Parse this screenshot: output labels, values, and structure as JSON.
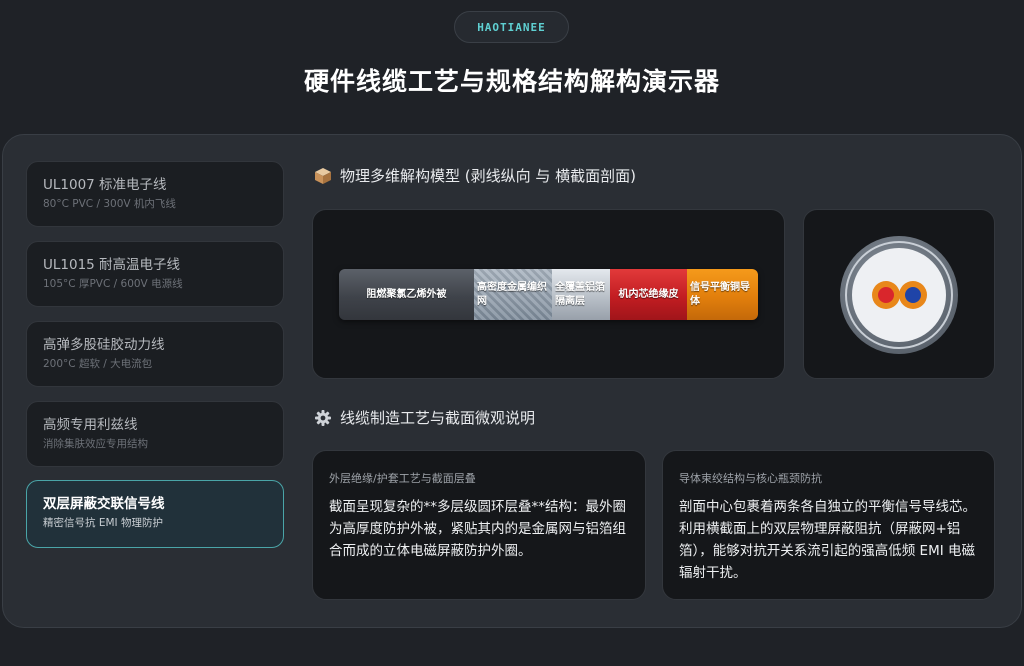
{
  "brand": "HAOTIANEE",
  "page_title": "硬件线缆工艺与规格结构解构演示器",
  "sidebar": {
    "items": [
      {
        "name": "UL1007 标准电子线",
        "sub": "80°C PVC / 300V 机内飞线"
      },
      {
        "name": "UL1015 耐高温电子线",
        "sub": "105°C 厚PVC / 600V 电源线"
      },
      {
        "name": "高弹多股硅胶动力线",
        "sub": "200°C 超软 / 大电流包"
      },
      {
        "name": "高频专用利兹线",
        "sub": "消除集肤效应专用结构"
      },
      {
        "name": "双层屏蔽交联信号线",
        "sub": "精密信号抗 EMI 物理防护"
      }
    ],
    "active_index": 4
  },
  "model_section": {
    "heading": "物理多维解构模型 (剥线纵向 与 横截面剖面)",
    "icon": "box-icon",
    "layers": [
      {
        "label": "阻燃聚氯乙烯外被",
        "color": "#4a4e55"
      },
      {
        "label": "高密度金属编织网",
        "color": "#8796a6"
      },
      {
        "label": "全覆盖铝箔隔离层",
        "color": "#c3c9d0"
      },
      {
        "label": "机内芯绝缘皮",
        "color": "#c21d22"
      },
      {
        "label": "信号平衡铜导体",
        "color": "#e27f0c"
      }
    ]
  },
  "process_section": {
    "heading": "线缆制造工艺与截面微观说明",
    "icon": "gear-icon",
    "cards": [
      {
        "caption": "外层绝缘/护套工艺与截面层叠",
        "body": "截面呈现复杂的**多层级圆环层叠**结构：最外圈为高厚度防护外被，紧贴其内的是金属网与铝箔组合而成的立体电磁屏蔽防护外圈。"
      },
      {
        "caption": "导体束绞结构与核心瓶颈防抗",
        "body": "剖面中心包裹着两条各自独立的平衡信号导线芯。利用横截面上的双层物理屏蔽阻抗（屏蔽网+铝箔），能够对抗开关系流引起的强高低频 EMI 电磁辐射干扰。"
      }
    ]
  },
  "colors": {
    "accent": "#4aa5a8",
    "core_red": "#d9262c",
    "core_blue": "#1f44a8",
    "core_orange": "#e8871a"
  }
}
